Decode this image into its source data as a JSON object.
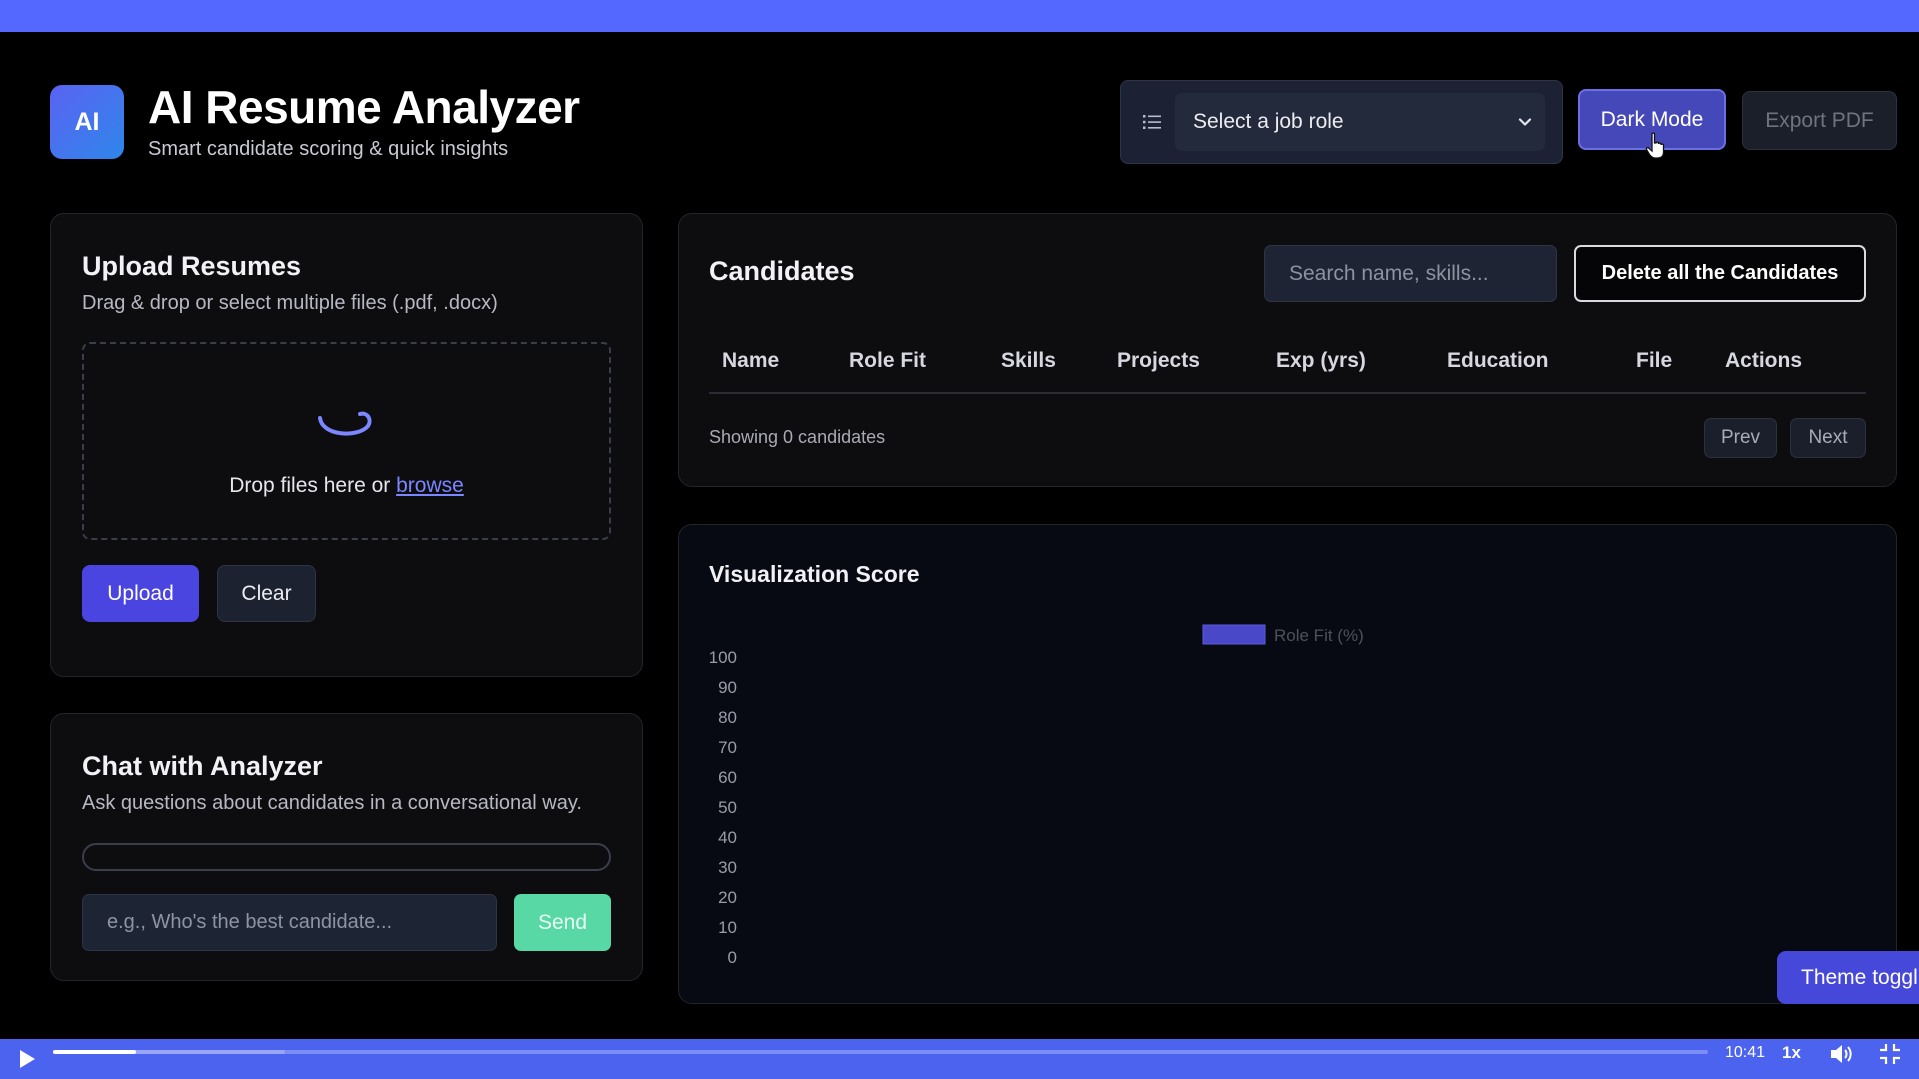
{
  "header": {
    "logo_text": "AI",
    "title": "AI Resume Analyzer",
    "subtitle": "Smart candidate scoring & quick insights",
    "role_select": {
      "selected": "Select a job role",
      "icon": "list-icon"
    },
    "dark_mode_label": "Dark Mode",
    "export_label": "Export PDF"
  },
  "upload": {
    "title": "Upload Resumes",
    "description": "Drag & drop or select multiple files (.pdf, .docx)",
    "drop_text": "Drop files here or ",
    "browse_label": "browse",
    "upload_label": "Upload",
    "clear_label": "Clear"
  },
  "chat": {
    "title": "Chat with Analyzer",
    "description": "Ask questions about candidates in a conversational way.",
    "input_placeholder": "e.g., Who's the best candidate...",
    "send_label": "Send"
  },
  "candidates": {
    "title": "Candidates",
    "search_placeholder": "Search name, skills...",
    "delete_all_label": "Delete all the Candidates",
    "columns": [
      "Name",
      "Role Fit",
      "Skills",
      "Projects",
      "Exp (yrs)",
      "Education",
      "File",
      "Actions"
    ],
    "rows": [],
    "showing_text": "Showing 0 candidates",
    "prev_label": "Prev",
    "next_label": "Next"
  },
  "visualization": {
    "title": "Visualization Score"
  },
  "chart_data": {
    "type": "bar",
    "categories": [],
    "series": [
      {
        "name": "Role Fit (%)",
        "values": [],
        "color": "#4a47c8"
      }
    ],
    "ylim": [
      0,
      100
    ],
    "yticks": [
      0,
      10,
      20,
      30,
      40,
      50,
      60,
      70,
      80,
      90,
      100
    ],
    "legend": "top-center",
    "grid": false
  },
  "theme_toggle_label": "Theme toggl",
  "video": {
    "time": "10:41",
    "speed": "1x",
    "played_fraction": 0.05,
    "buffered_fraction": 0.14
  },
  "colors": {
    "accent": "#5468ff",
    "primary_button": "#4a45e0",
    "send_button": "#58d8a4",
    "link": "#7b86ff"
  }
}
